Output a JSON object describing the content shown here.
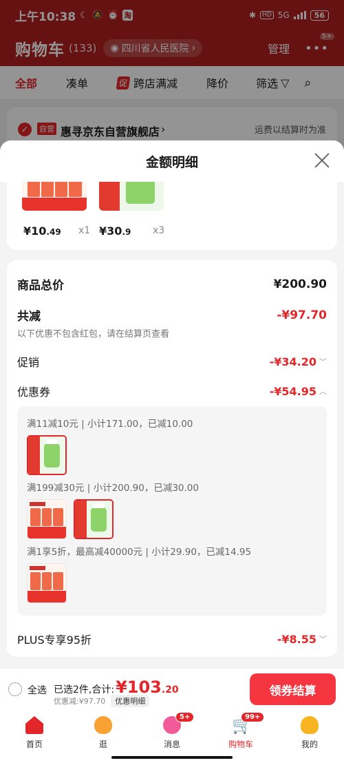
{
  "status_bar": {
    "time": "上午10:38",
    "network": "5G",
    "battery": "56"
  },
  "header": {
    "title": "购物车",
    "count": "(133)",
    "location": "四川省人民医院",
    "manage": "管理",
    "more_badge": "5+"
  },
  "filters": {
    "all": "全部",
    "combine": "凑单",
    "cross_tag": "促",
    "cross_store": "跨店满减",
    "price_drop": "降价",
    "filter": "筛选"
  },
  "store": {
    "tag": "自营",
    "name": "惠寻京东自营旗舰店",
    "shipping_note": "运费以结算时为准"
  },
  "modal": {
    "title": "金额明细",
    "goods": [
      {
        "price_int": "¥10",
        "price_dec": ".49",
        "qty": "x1"
      },
      {
        "price_int": "¥30",
        "price_dec": ".9",
        "qty": "x3"
      }
    ],
    "total_label": "商品总价",
    "total_value": "¥200.90",
    "reduce_label": "共减",
    "reduce_value": "-¥97.70",
    "reduce_note": "以下优惠不包含红包，请在结算页查看",
    "promo_label": "促销",
    "promo_value": "-¥34.20",
    "coupon_label": "优惠券",
    "coupon_value": "-¥54.95",
    "coupon_groups": [
      {
        "text": "满11减10元 | 小计171.00，已减10.00"
      },
      {
        "text": "满199减30元 | 小计200.90，已减30.00"
      },
      {
        "text": "满1享5折，最高减40000元 | 小计29.90，已减14.95"
      }
    ],
    "plus_label": "PLUS专享95折",
    "plus_value": "-¥8.55"
  },
  "checkout": {
    "select_all": "全选",
    "summary": "已选2件,合计:",
    "amount_int": "¥103",
    "amount_dec": ".20",
    "discount": "优惠减:¥97.70",
    "detail_btn": "优惠明细",
    "pay_btn": "领券结算"
  },
  "tabs": [
    {
      "label": "首页",
      "icon": "home-icon"
    },
    {
      "label": "逛",
      "icon": "stroll-icon"
    },
    {
      "label": "消息",
      "icon": "message-icon",
      "badge": "5+"
    },
    {
      "label": "购物车",
      "icon": "cart-icon",
      "badge": "99+"
    },
    {
      "label": "我的",
      "icon": "profile-icon"
    }
  ],
  "colors": {
    "brand_red": "#e3262a",
    "header_red": "#b02020",
    "pay_button": "#f5353f"
  }
}
